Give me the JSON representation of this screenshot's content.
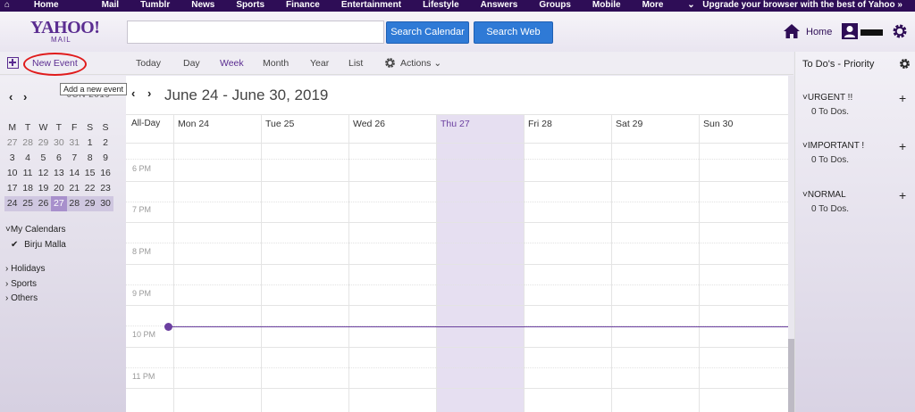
{
  "topnav": {
    "items": [
      "Home",
      "Mail",
      "Tumblr",
      "News",
      "Sports",
      "Finance",
      "Entertainment",
      "Lifestyle",
      "Answers",
      "Groups",
      "Mobile",
      "More"
    ],
    "upgrade": "Upgrade your browser with the best of Yahoo »"
  },
  "header": {
    "logo": "YAHOO!",
    "logo_sub": "MAIL",
    "search_value": "",
    "search_calendar": "Search Calendar",
    "search_web": "Search Web",
    "home": "Home"
  },
  "toolbar": {
    "new_event": "New Event",
    "tooltip": "Add a new event",
    "views": [
      "Today",
      "Day",
      "Week",
      "Month",
      "Year",
      "List"
    ],
    "active_view": "Week",
    "actions": "Actions"
  },
  "minical": {
    "month": "JUN 2019",
    "weekdays": [
      "M",
      "T",
      "W",
      "T",
      "F",
      "S",
      "S"
    ],
    "weeks": [
      [
        "27",
        "28",
        "29",
        "30",
        "31",
        "1",
        "2"
      ],
      [
        "3",
        "4",
        "5",
        "6",
        "7",
        "8",
        "9"
      ],
      [
        "10",
        "11",
        "12",
        "13",
        "14",
        "15",
        "16"
      ],
      [
        "17",
        "18",
        "19",
        "20",
        "21",
        "22",
        "23"
      ],
      [
        "24",
        "25",
        "26",
        "27",
        "28",
        "29",
        "30"
      ]
    ],
    "today": "27"
  },
  "calendars": {
    "my_calendars": "My Calendars",
    "owner": "Birju Malla",
    "others": [
      "Holidays",
      "Sports",
      "Others"
    ]
  },
  "week": {
    "range": "June 24 - June 30, 2019",
    "all_day": "All-Day",
    "days": [
      "Mon 24",
      "Tue 25",
      "Wed 26",
      "Thu 27",
      "Fri 28",
      "Sat 29",
      "Sun 30"
    ],
    "today_index": 3,
    "times": [
      "6 PM",
      "7 PM",
      "8 PM",
      "9 PM",
      "10 PM",
      "11 PM"
    ]
  },
  "todo": {
    "title": "To Do's - Priority",
    "groups": [
      {
        "name": "URGENT !!",
        "count": "0 To Dos."
      },
      {
        "name": "IMPORTANT !",
        "count": "0 To Dos."
      },
      {
        "name": "NORMAL",
        "count": "0 To Dos."
      }
    ]
  },
  "colors": {
    "brand": "#5b2d91",
    "nav": "#2e0d56",
    "button": "#2f7ad6",
    "today_column": "#e6dff1",
    "highlight_oval": "#e01b1b"
  }
}
